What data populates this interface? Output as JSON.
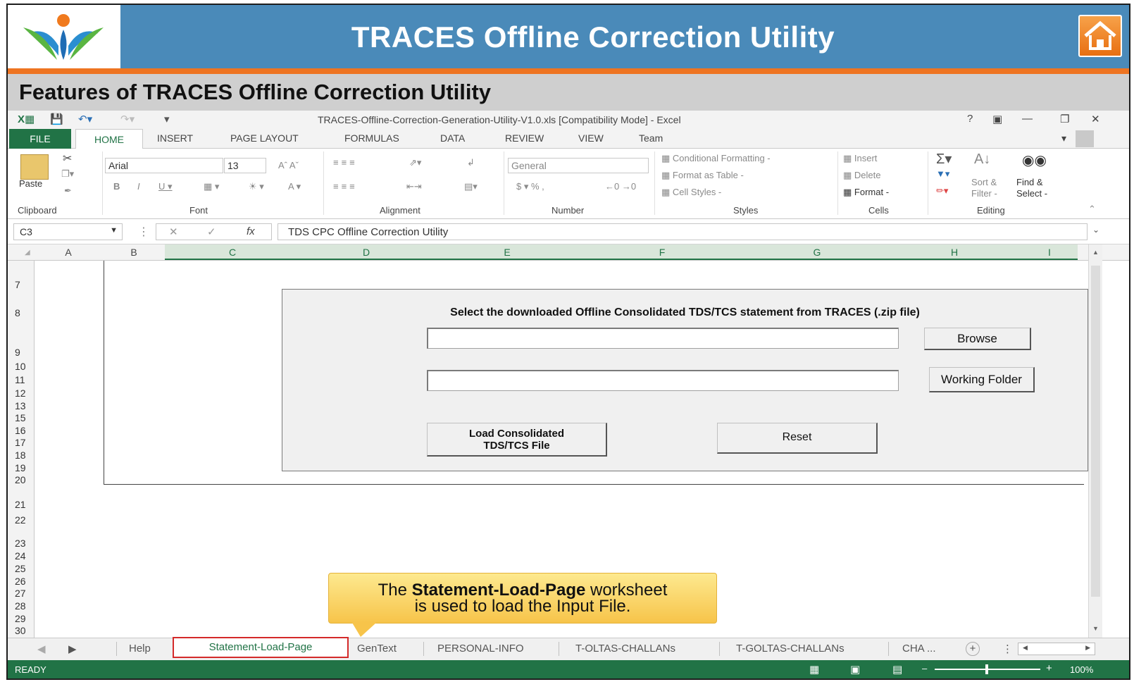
{
  "banner": {
    "title": "TRACES Offline Correction Utility"
  },
  "subtitle": "Features of TRACES Offline Correction Utility",
  "excel": {
    "doc_title": "TRACES-Offline-Correction-Generation-Utility-V1.0.xls  [Compatibility Mode] - Excel",
    "tabs": [
      "FILE",
      "HOME",
      "INSERT",
      "PAGE LAYOUT",
      "FORMULAS",
      "DATA",
      "REVIEW",
      "VIEW",
      "Team"
    ],
    "help_glyph": "?",
    "ribbon": {
      "paste": "Paste",
      "font_name": "Arial",
      "font_size": "13",
      "number_format": "General",
      "conditional": "Conditional Formatting -",
      "format_table": "Format as Table -",
      "cell_styles": "Cell Styles -",
      "insert": "Insert",
      "delete": "Delete",
      "format": "Format -",
      "sort": "Sort &\nFilter -",
      "find": "Find &\nSelect -",
      "groups": [
        "Clipboard",
        "Font",
        "Alignment",
        "Number",
        "Styles",
        "Cells",
        "Editing"
      ]
    },
    "name_box": "C3",
    "fx": "fx",
    "formula": "TDS CPC Offline Correction Utility",
    "columns": [
      "A",
      "B",
      "C",
      "D",
      "E",
      "F",
      "G",
      "H",
      "I"
    ],
    "rows": [
      "7",
      "8",
      "9",
      "10",
      "11",
      "12",
      "13",
      "15",
      "16",
      "17",
      "18",
      "19",
      "20",
      "21",
      "22",
      "23",
      "24",
      "25",
      "26",
      "27",
      "28",
      "29",
      "30"
    ]
  },
  "panel": {
    "title": "Select the downloaded Offline Consolidated TDS/TCS statement from TRACES (.zip file)",
    "file_path_value": "",
    "folder_path_value": "",
    "browse": "Browse",
    "working_folder": "Working Folder",
    "load_line1": "Load Consolidated",
    "load_line2": "TDS/TCS File",
    "reset": "Reset"
  },
  "callout": {
    "pre": "The ",
    "bold": "Statement-Load-Page",
    "post": " worksheet",
    "line2": "is used to load the Input File."
  },
  "sheets": {
    "help": "Help",
    "active": "Statement-Load-Page",
    "gentext": "GenText",
    "personal": "PERSONAL-INFO",
    "oltas": "T-OLTAS-CHALLANs",
    "goltas": "T-GOLTAS-CHALLANs",
    "cha": "CHA ...",
    "add_glyph": "+"
  },
  "status": {
    "ready": "READY",
    "zoom": "100%"
  },
  "colors": {
    "excel_green": "#217346",
    "banner_blue": "#4a8ab9",
    "accent_orange": "#ee7421"
  }
}
